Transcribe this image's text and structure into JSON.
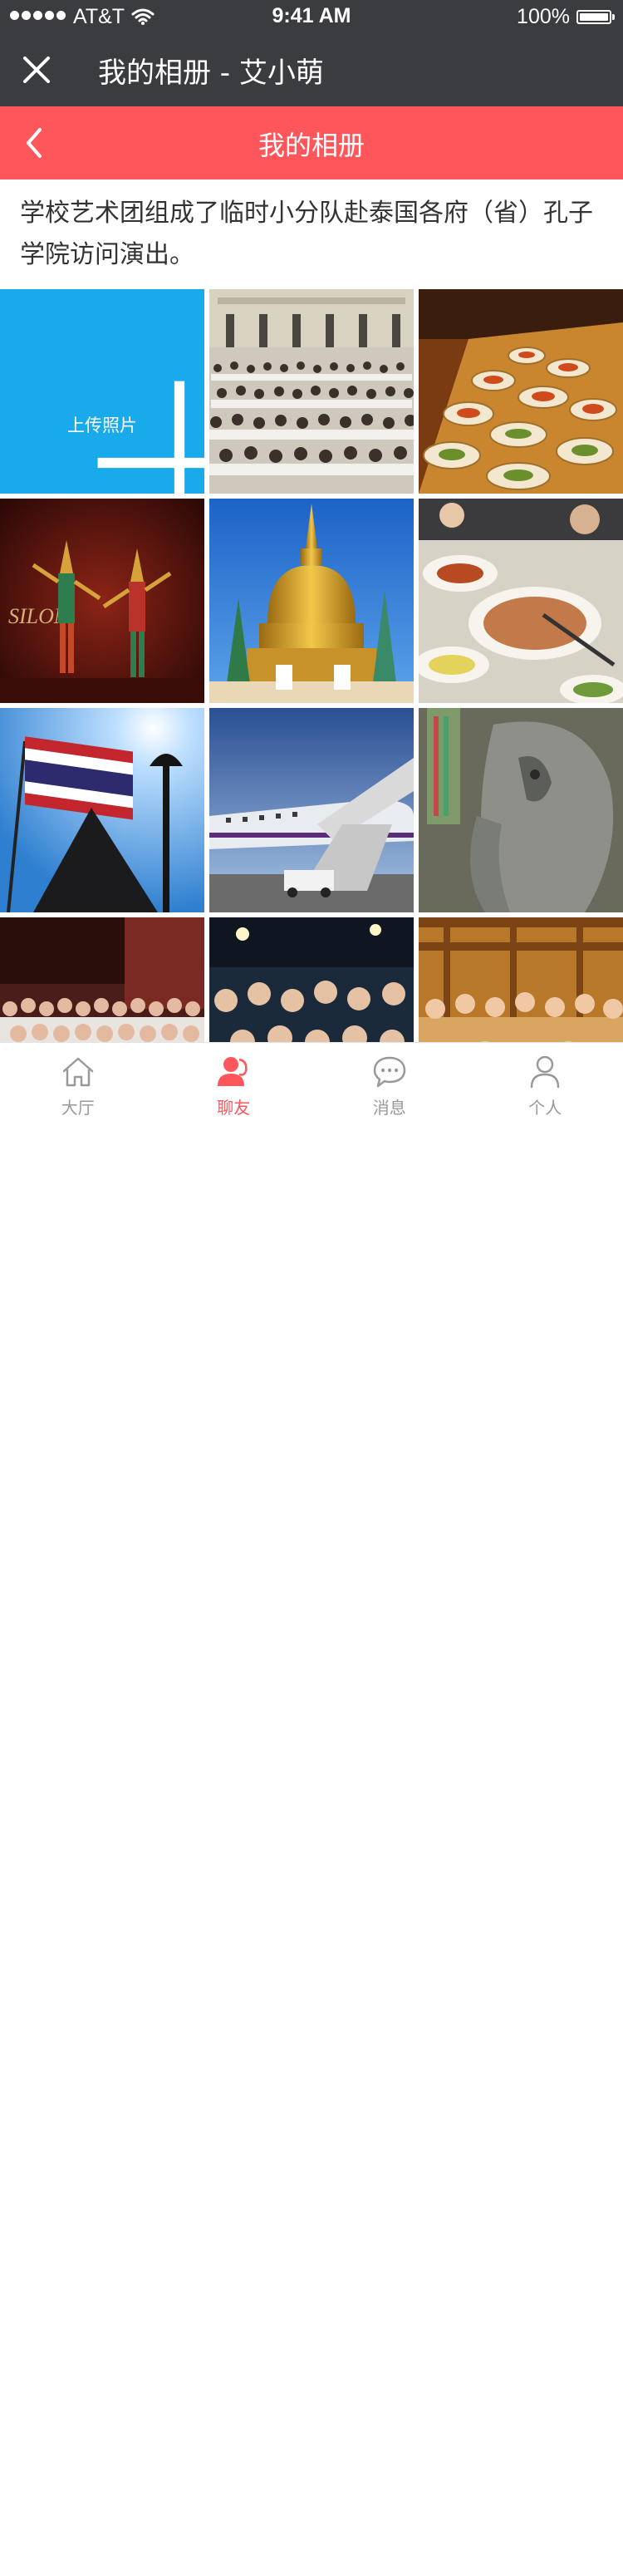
{
  "status_bar": {
    "carrier": "AT&T",
    "time": "9:41 AM",
    "battery": "100%"
  },
  "header": {
    "title": "我的相册 - 艾小萌",
    "close_icon": "close-icon"
  },
  "nav": {
    "title": "我的相册",
    "back_icon": "chevron-left-icon"
  },
  "album": {
    "description": "学校艺术团组成了临时小分队赴泰国各府（省）孔子学院访问演出。"
  },
  "upload": {
    "label": "上传照片",
    "icon": "plus-icon"
  },
  "photos": [
    "auditorium-crowd",
    "banquet-table",
    "thai-dance-performers",
    "golden-stupa",
    "soup-dishes",
    "thai-flag",
    "airplane-boarding",
    "elephant-statue",
    "stage-group-photo",
    "reception-group",
    "restaurant-group"
  ],
  "tabs": [
    {
      "label": "大厅",
      "icon": "house-icon",
      "active": false
    },
    {
      "label": "聊友",
      "icon": "friends-icon",
      "active": true
    },
    {
      "label": "消息",
      "icon": "chat-bubble-icon",
      "active": false
    },
    {
      "label": "个人",
      "icon": "person-icon",
      "active": false
    }
  ],
  "colors": {
    "header_bg": "#3b3c3f",
    "accent": "#fe565a",
    "upload_bg": "#19aaec",
    "tab_inactive": "#999999"
  }
}
